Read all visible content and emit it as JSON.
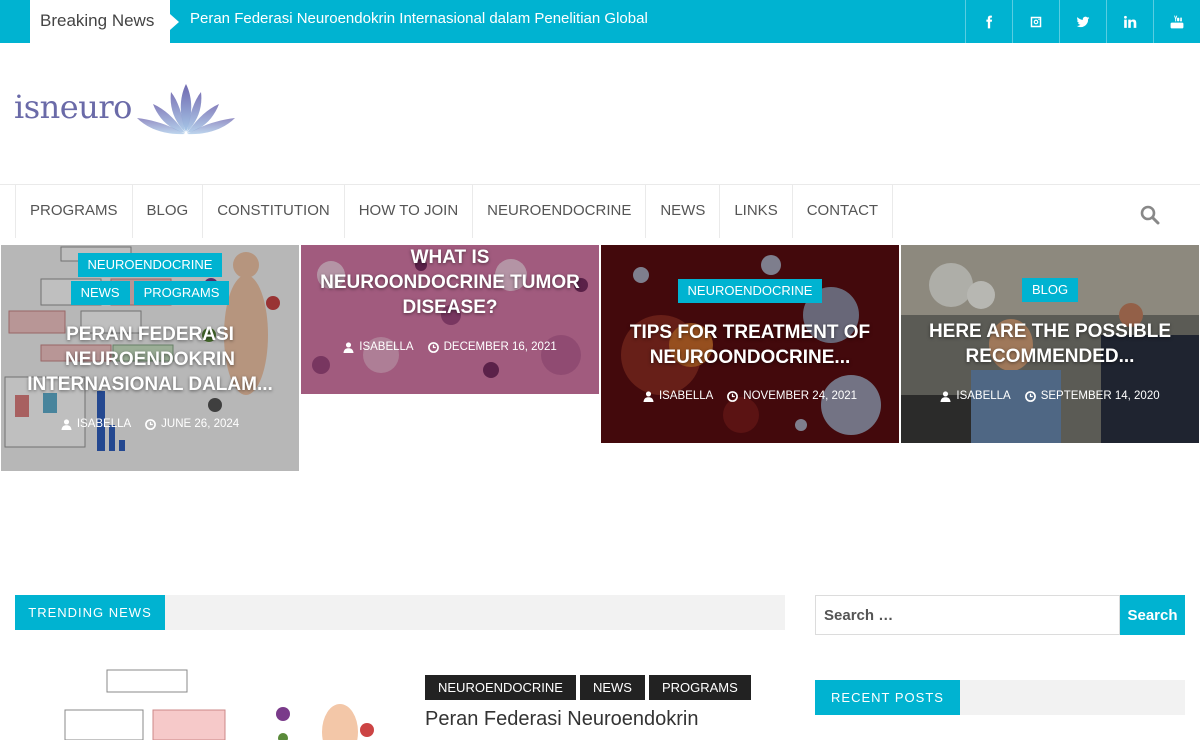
{
  "topbar": {
    "breaking_label": "Breaking News",
    "breaking_headline": "Peran Federasi Neuroendokrin Internasional dalam Penelitian Global",
    "socials": [
      "facebook-icon",
      "instagram-icon",
      "twitter-icon",
      "linkedin-icon",
      "youtube-icon"
    ],
    "accent_color": "#00b3d1"
  },
  "logo": {
    "text": "isneuro"
  },
  "nav": {
    "items": [
      "PROGRAMS",
      "BLOG",
      "CONSTITUTION",
      "HOW TO JOIN",
      "NEUROENDOCRINE",
      "NEWS",
      "LINKS",
      "CONTACT"
    ]
  },
  "featured": [
    {
      "tags": [
        "NEUROENDOCRINE",
        "NEWS",
        "PROGRAMS"
      ],
      "title": "PERAN FEDERASI NEUROENDOKRIN INTERNASIONAL DALAM...",
      "author": "ISABELLA",
      "date": "JUNE 26, 2024"
    },
    {
      "tags": [],
      "title": "WHAT IS NEUROONDOCRINE TUMOR DISEASE?",
      "author": "ISABELLA",
      "date": "DECEMBER 16, 2021"
    },
    {
      "tags": [
        "NEUROENDOCRINE"
      ],
      "title": "TIPS FOR TREATMENT OF NEUROONDOCRINE...",
      "author": "ISABELLA",
      "date": "NOVEMBER 24, 2021"
    },
    {
      "tags": [
        "BLOG"
      ],
      "title": "HERE ARE THE POSSIBLE RECOMMENDED...",
      "author": "ISABELLA",
      "date": "SEPTEMBER 14, 2020"
    }
  ],
  "trending": {
    "label": "TRENDING NEWS",
    "tags": [
      "NEUROENDOCRINE",
      "NEWS",
      "PROGRAMS"
    ],
    "title": "Peran Federasi Neuroendokrin"
  },
  "sidebar": {
    "search_placeholder": "Search …",
    "search_button": "Search",
    "recent_label": "RECENT POSTS"
  }
}
